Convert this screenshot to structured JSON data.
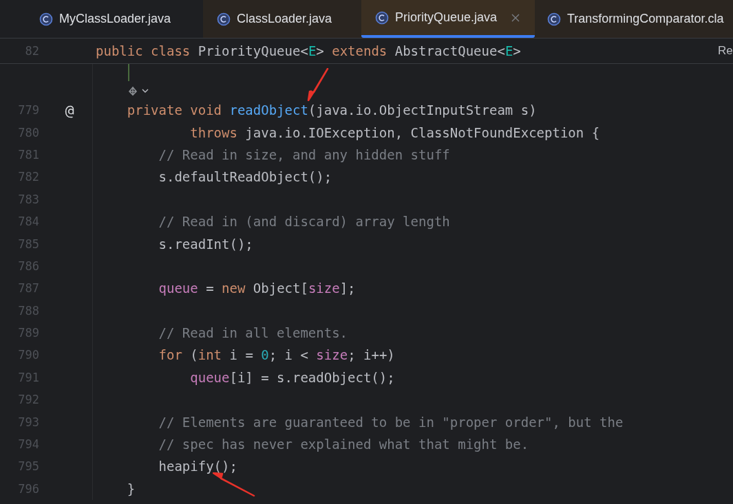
{
  "tabs": [
    {
      "label": "MyClassLoader.java",
      "selected": false,
      "closable": false
    },
    {
      "label": "ClassLoader.java",
      "selected": false,
      "closable": false
    },
    {
      "label": "PriorityQueue.java",
      "selected": true,
      "closable": true
    },
    {
      "label": "TransformingComparator.cla",
      "selected": false,
      "closable": false
    }
  ],
  "sticky_header": {
    "number": "82",
    "tokens": [
      {
        "kind": "keyword",
        "text": "public class "
      },
      {
        "kind": "plain",
        "text": "PriorityQueue<"
      },
      {
        "kind": "typeparam",
        "text": "E"
      },
      {
        "kind": "plain",
        "text": "> "
      },
      {
        "kind": "keyword",
        "text": "extends "
      },
      {
        "kind": "plain",
        "text": "AbstractQueue<"
      },
      {
        "kind": "typeparam",
        "text": "E"
      },
      {
        "kind": "plain",
        "text": ">"
      }
    ],
    "side_label": "Re"
  },
  "lines": [
    {
      "number": "779",
      "gutter": "@",
      "tokens": [
        {
          "kind": "keyword",
          "text": "    private void "
        },
        {
          "kind": "function",
          "text": "readObject",
          "arrow_from_above": true
        },
        {
          "kind": "plain",
          "text": "(java.io.ObjectInputStream s)"
        }
      ]
    },
    {
      "number": "780",
      "tokens": [
        {
          "kind": "keyword",
          "text": "            throws "
        },
        {
          "kind": "plain",
          "text": "java.io.IOException, ClassNotFoundException {"
        }
      ]
    },
    {
      "number": "781",
      "tokens": [
        {
          "kind": "comment",
          "text": "        // Read in size, and any hidden stuff"
        }
      ]
    },
    {
      "number": "782",
      "tokens": [
        {
          "kind": "plain",
          "text": "        s.defaultReadObject();"
        }
      ]
    },
    {
      "number": "783"
    },
    {
      "number": "784",
      "tokens": [
        {
          "kind": "comment",
          "text": "        // Read in (and discard) array length"
        }
      ]
    },
    {
      "number": "785",
      "tokens": [
        {
          "kind": "plain",
          "text": "        s.readInt();"
        }
      ]
    },
    {
      "number": "786"
    },
    {
      "number": "787",
      "tokens": [
        {
          "kind": "field",
          "text": "        queue "
        },
        {
          "kind": "plain",
          "text": "= "
        },
        {
          "kind": "keyword",
          "text": "new "
        },
        {
          "kind": "plain",
          "text": "Object["
        },
        {
          "kind": "field",
          "text": "size"
        },
        {
          "kind": "plain",
          "text": "];"
        }
      ]
    },
    {
      "number": "788"
    },
    {
      "number": "789",
      "tokens": [
        {
          "kind": "comment",
          "text": "        // Read in all elements."
        }
      ]
    },
    {
      "number": "790",
      "tokens": [
        {
          "kind": "keyword",
          "text": "        for "
        },
        {
          "kind": "plain",
          "text": "("
        },
        {
          "kind": "keyword",
          "text": "int "
        },
        {
          "kind": "plain",
          "text": "i = "
        },
        {
          "kind": "number",
          "text": "0"
        },
        {
          "kind": "plain",
          "text": "; i < "
        },
        {
          "kind": "field",
          "text": "size"
        },
        {
          "kind": "plain",
          "text": "; i++)"
        }
      ]
    },
    {
      "number": "791",
      "tokens": [
        {
          "kind": "field",
          "text": "            queue"
        },
        {
          "kind": "plain",
          "text": "[i] = s.readObject();"
        }
      ]
    },
    {
      "number": "792"
    },
    {
      "number": "793",
      "tokens": [
        {
          "kind": "comment",
          "text": "        // Elements are guaranteed to be in \"proper order\", but the"
        }
      ]
    },
    {
      "number": "794",
      "tokens": [
        {
          "kind": "comment",
          "text": "        // spec has never explained what that might be."
        }
      ]
    },
    {
      "number": "795",
      "tokens": [
        {
          "kind": "plain",
          "text": "        heapify",
          "arrow_from_below": true
        },
        {
          "kind": "plain",
          "text": "();"
        }
      ]
    },
    {
      "number": "796",
      "tokens": [
        {
          "kind": "plain",
          "text": "    }"
        }
      ]
    }
  ]
}
